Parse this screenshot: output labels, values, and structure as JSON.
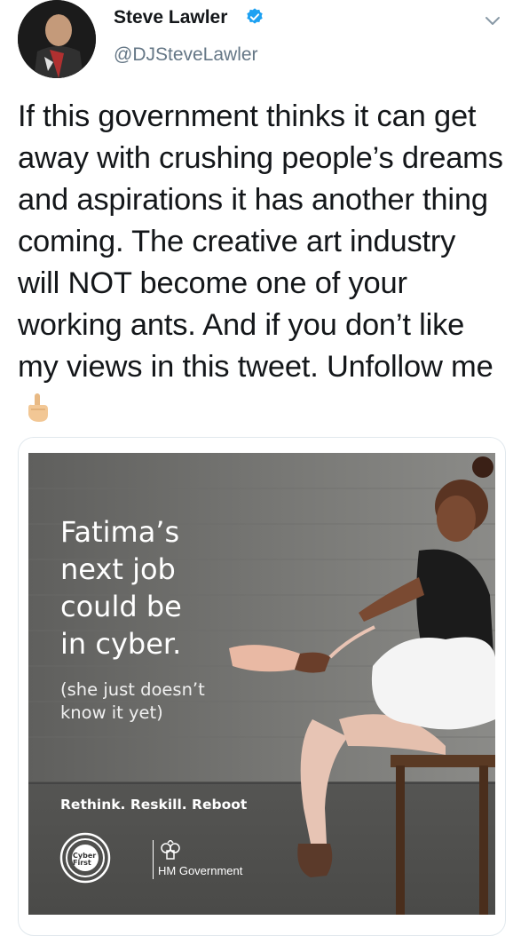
{
  "author": {
    "name": "Steve Lawler",
    "handle": "@DJSteveLawler",
    "verified_color": "#1da1f2"
  },
  "tweet": {
    "text": "If this government thinks it can get away with crushing people’s dreams and aspirations it has another thing coming. The creative art industry will NOT become one of your working ants. And if you don’t like my views in this tweet. Unfollow me",
    "emoji": "middle-finger-emoji"
  },
  "ad": {
    "headline": "Fatima’s\nnext job\ncould be\nin cyber.",
    "subtext": "(she just doesn’t\nknow it yet)",
    "tagline": "Rethink. Reskill. Reboot",
    "cyber_logo_text": "Cyber\nFirst",
    "gov_text": "HM Government"
  },
  "icons": {
    "verified": "verified-badge-icon",
    "menu": "chevron-down-icon"
  }
}
